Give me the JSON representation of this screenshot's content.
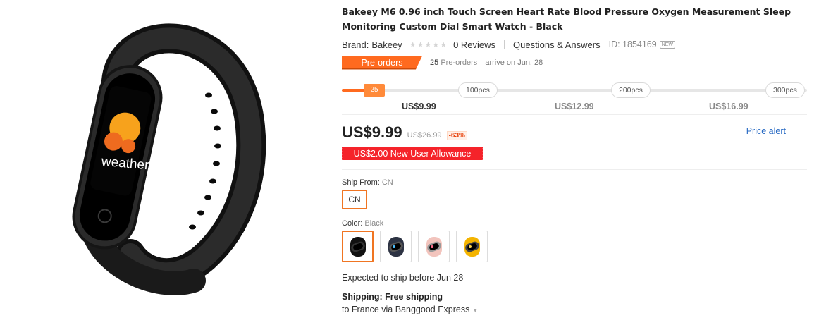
{
  "product": {
    "title": "Bakeey M6 0.96 inch Touch Screen Heart Rate Blood Pressure Oxygen Measurement Sleep Monitoring Custom Dial Smart Watch - Black",
    "image_label": "weather",
    "brand_label": "Brand:",
    "brand_name": "Bakeey",
    "rating": 0,
    "reviews": "0 Reviews",
    "qa": "Questions & Answers",
    "id": "ID: 1854169",
    "new_tag": "NEW"
  },
  "preorder": {
    "tag": "Pre-orders",
    "count": "25",
    "count_label": "Pre-orders",
    "arrive": "arrive on Jun. 28"
  },
  "tiers": {
    "current_qty": "25",
    "progress": 0.046,
    "steps": [
      {
        "qty": "100pcs",
        "price": "US$9.99"
      },
      {
        "qty": "200pcs",
        "price": "US$12.99"
      },
      {
        "qty": "300pcs",
        "price": "US$16.99"
      }
    ]
  },
  "price": {
    "now": "US$9.99",
    "old": "US$26.99",
    "discount": "-63%",
    "alert": "Price alert",
    "allowance": "US$2.00 New User Allowance"
  },
  "ship_from": {
    "label": "Ship From:",
    "value": "CN",
    "option": "CN"
  },
  "color": {
    "label": "Color:",
    "value": "Black",
    "swatches": [
      "black",
      "dark-navy",
      "pink",
      "yellow"
    ]
  },
  "shipping": {
    "expected": "Expected to ship before Jun 28",
    "label": "Shipping:",
    "value": "Free shipping",
    "to": "to France via Banggood Express"
  },
  "colors": {
    "accent": "#ff6a1f",
    "allowance_red": "#f5232a",
    "link_blue": "#2b6cc4"
  }
}
